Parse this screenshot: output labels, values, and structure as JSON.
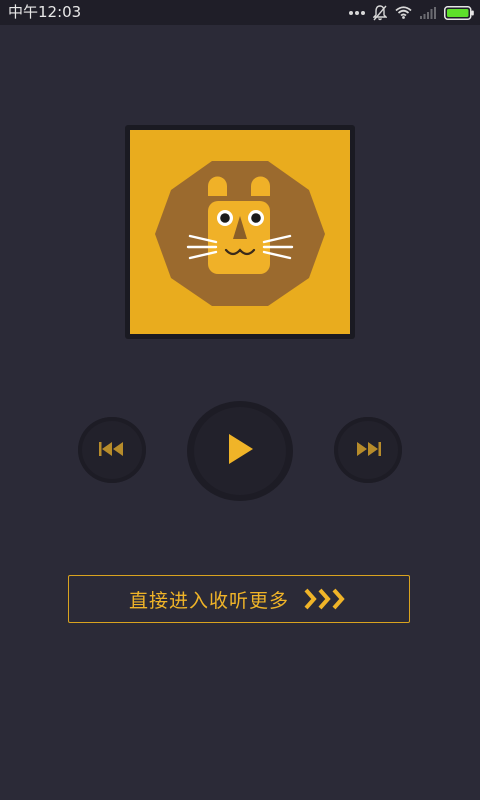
{
  "status_bar": {
    "time": "中午12:03",
    "icons": [
      "more-dots-icon",
      "notifications-off-icon",
      "wifi-icon",
      "signal-icon",
      "battery-icon"
    ],
    "battery_color": "#5ee02a"
  },
  "player": {
    "album_art": "lion-face-icon",
    "controls": {
      "previous": "skip-previous-icon",
      "play": "play-icon",
      "next": "skip-next-icon"
    }
  },
  "cta": {
    "label": "直接进入收听更多",
    "icon": "triple-chevron-right-icon"
  },
  "colors": {
    "background": "#2b2a37",
    "accent": "#f0b428",
    "album_background": "#e9ac1e",
    "mane": "#9b6a2e"
  }
}
